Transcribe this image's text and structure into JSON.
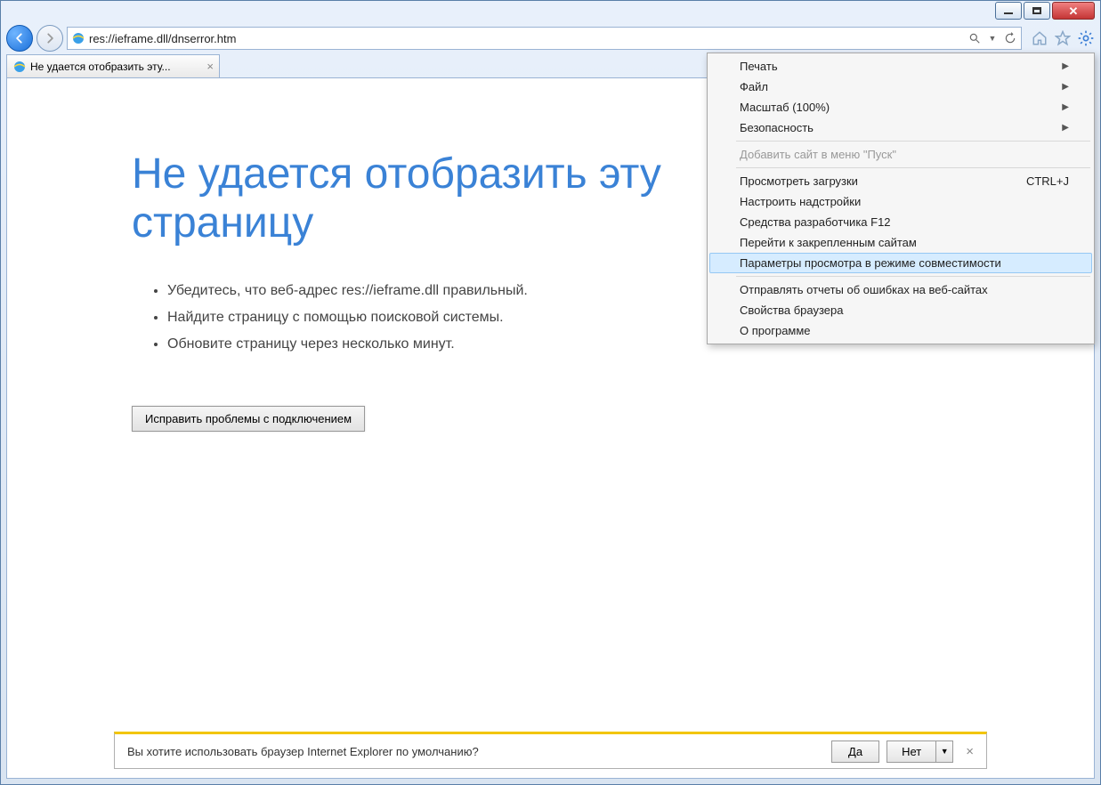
{
  "addressbar": {
    "url": "res://ieframe.dll/dnserror.htm"
  },
  "tab": {
    "title": "Не удается отобразить эту..."
  },
  "error": {
    "heading": "Не удается отобразить эту страницу",
    "bullets": [
      "Убедитесь, что веб-адрес res://ieframe.dll правильный.",
      "Найдите страницу с помощью поисковой системы.",
      "Обновите страницу через несколько минут."
    ],
    "fix_button": "Исправить проблемы с подключением"
  },
  "menu": {
    "items": [
      {
        "label": "Печать",
        "submenu": true
      },
      {
        "label": "Файл",
        "submenu": true
      },
      {
        "label": "Масштаб (100%)",
        "submenu": true
      },
      {
        "label": "Безопасность",
        "submenu": true
      },
      {
        "sep": true
      },
      {
        "label": "Добавить сайт в меню \"Пуск\"",
        "disabled": true
      },
      {
        "sep": true
      },
      {
        "label": "Просмотреть загрузки",
        "shortcut": "CTRL+J"
      },
      {
        "label": "Настроить надстройки"
      },
      {
        "label": "Средства разработчика F12"
      },
      {
        "label": "Перейти к закрепленным сайтам"
      },
      {
        "label": "Параметры просмотра в режиме совместимости",
        "hover": true
      },
      {
        "sep": true
      },
      {
        "label": "Отправлять отчеты об ошибках на веб-сайтах"
      },
      {
        "label": "Свойства браузера"
      },
      {
        "label": "О программе"
      }
    ]
  },
  "notification": {
    "text": "Вы хотите использовать браузер Internet Explorer по умолчанию?",
    "yes": "Да",
    "no": "Нет"
  }
}
